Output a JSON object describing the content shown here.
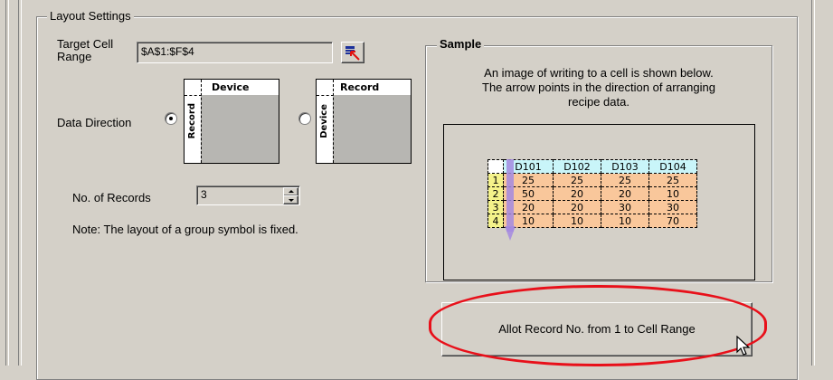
{
  "group": {
    "title": "Layout Settings"
  },
  "target_cell": {
    "label_line1": "Target Cell",
    "label_line2": "Range",
    "value": "$A$1:$F$4"
  },
  "data_direction": {
    "label": "Data Direction",
    "option1": {
      "top_header": "Device",
      "side_header": "Record",
      "selected": true
    },
    "option2": {
      "top_header": "Record",
      "side_header": "Device",
      "selected": false
    }
  },
  "records": {
    "label": "No. of Records",
    "value": "3"
  },
  "note": "Note: The layout of a group symbol is fixed.",
  "sample": {
    "title": "Sample",
    "desc_line1": "An image of writing to a cell is shown below.",
    "desc_line2": "The arrow points in the direction of arranging",
    "desc_line3": "recipe data.",
    "headers": [
      "D101",
      "D102",
      "D103",
      "D104"
    ],
    "row_numbers": [
      "1",
      "2",
      "3",
      "4"
    ],
    "rows": [
      [
        "25",
        "25",
        "25",
        "25"
      ],
      [
        "50",
        "20",
        "20",
        "10"
      ],
      [
        "20",
        "20",
        "30",
        "30"
      ],
      [
        "10",
        "10",
        "10",
        "70"
      ]
    ]
  },
  "allot_button": {
    "label": "Allot Record No. from 1 to Cell Range"
  },
  "colors": {
    "highlight": "#e8101a",
    "header_cell": "#c9f5f9",
    "row_num": "#f4f28a",
    "data_cell": "#f9c79b",
    "arrow": "#a48ae0"
  }
}
